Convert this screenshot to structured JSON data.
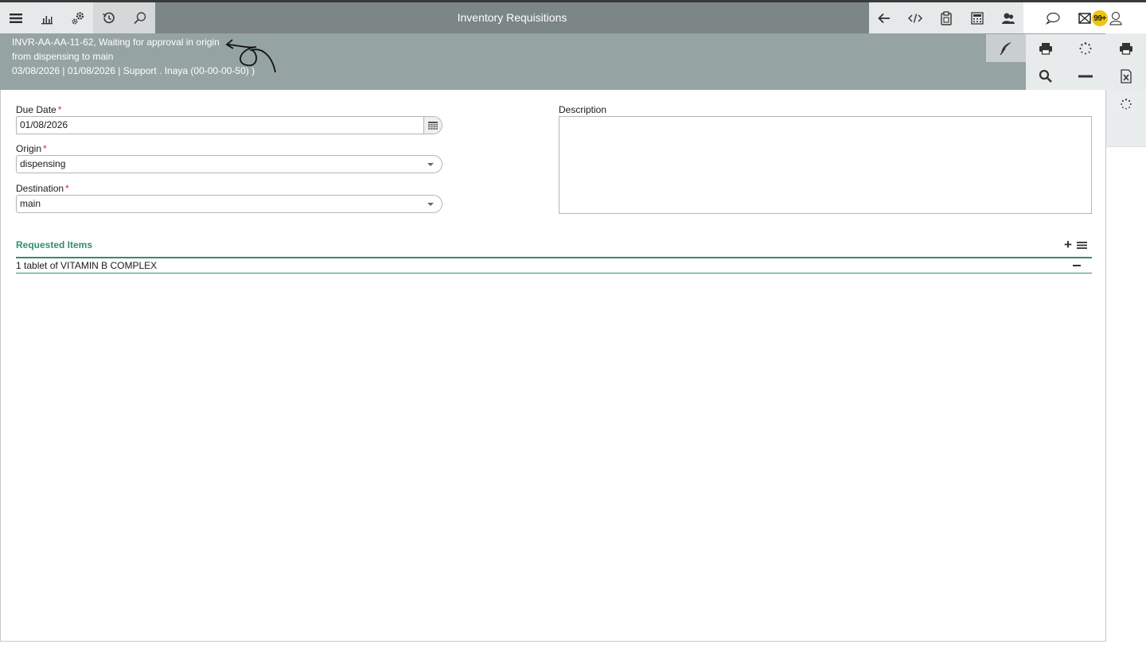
{
  "app": {
    "title": "Inventory Requisitions"
  },
  "toolbar": {
    "left": [
      "menu-icon",
      "bar-chart-icon",
      "settings-gears-icon",
      "history-icon",
      "search-icon"
    ],
    "right": [
      "back-arrow-icon",
      "code-icon",
      "clipboard-icon",
      "calculator-icon",
      "users-icon"
    ],
    "user": {
      "notification_badge": "99+"
    }
  },
  "header": {
    "line1": "INVR-AA-AA-11-62, Waiting for approval in origin",
    "line2": "from dispensing to main",
    "line3": "03/08/2026 | 01/08/2026 | Support . Inaya (00-00-00-50) )"
  },
  "form": {
    "due_date": {
      "label": "Due Date",
      "value": "01/08/2026",
      "required": "*"
    },
    "origin": {
      "label": "Origin",
      "value": "dispensing",
      "required": "*"
    },
    "destination": {
      "label": "Destination",
      "value": "main",
      "required": "*"
    },
    "description": {
      "label": "Description",
      "value": ""
    }
  },
  "requested_items": {
    "title": "Requested Items",
    "add_symbol": "+",
    "items": [
      {
        "text": "1 tablet of VITAMIN B COMPLEX"
      }
    ]
  },
  "colors": {
    "topbar": "#7b8685",
    "header": "#95a3a2",
    "accent": "#2e8f73",
    "required": "#d9272e",
    "badge": "#f2c40f"
  }
}
